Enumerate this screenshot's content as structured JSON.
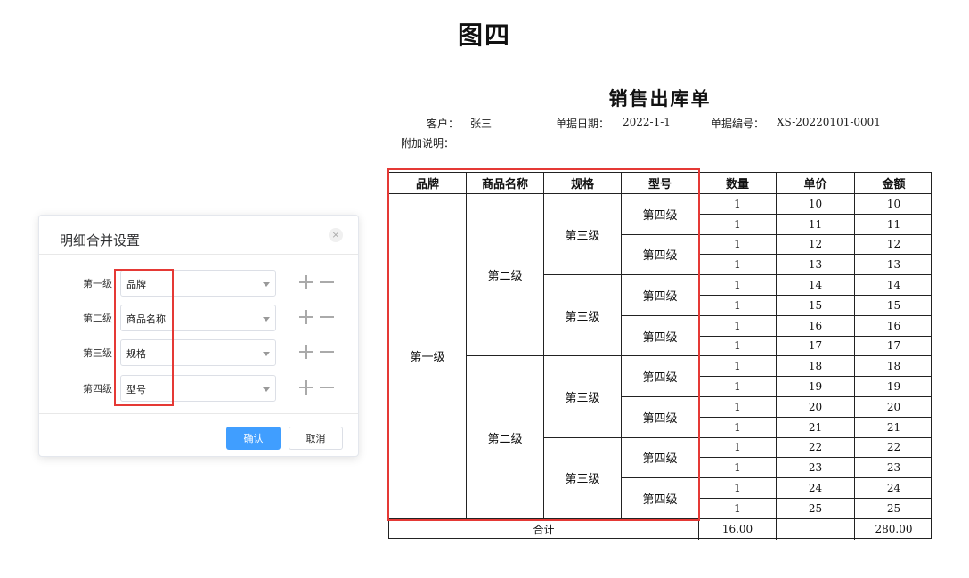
{
  "figure_title": "图四",
  "dialog": {
    "title": "明细合并设置",
    "close_glyph": "×",
    "levels": [
      {
        "label": "第一级",
        "value": "品牌"
      },
      {
        "label": "第二级",
        "value": "商品名称"
      },
      {
        "label": "第三级",
        "value": "规格"
      },
      {
        "label": "第四级",
        "value": "型号"
      }
    ],
    "confirm_label": "确认",
    "cancel_label": "取消",
    "accent_color": "#409eff"
  },
  "document": {
    "title": "销售出库单",
    "customer_label": "客户：",
    "customer_value": "张三",
    "date_label": "单据日期：",
    "date_value": "2022-1-1",
    "number_label": "单据编号：",
    "number_value": "XS-20220101-0001",
    "note_label": "附加说明：",
    "headers": [
      "品牌",
      "商品名称",
      "规格",
      "型号",
      "数量",
      "单价",
      "金额"
    ],
    "merged": {
      "level1": "第一级",
      "level2": "第二级",
      "level3": "第三级",
      "level4": "第四级"
    },
    "rows": [
      {
        "qty": "1",
        "price": "10",
        "amount": "10"
      },
      {
        "qty": "1",
        "price": "11",
        "amount": "11"
      },
      {
        "qty": "1",
        "price": "12",
        "amount": "12"
      },
      {
        "qty": "1",
        "price": "13",
        "amount": "13"
      },
      {
        "qty": "1",
        "price": "14",
        "amount": "14"
      },
      {
        "qty": "1",
        "price": "15",
        "amount": "15"
      },
      {
        "qty": "1",
        "price": "16",
        "amount": "16"
      },
      {
        "qty": "1",
        "price": "17",
        "amount": "17"
      },
      {
        "qty": "1",
        "price": "18",
        "amount": "18"
      },
      {
        "qty": "1",
        "price": "19",
        "amount": "19"
      },
      {
        "qty": "1",
        "price": "20",
        "amount": "20"
      },
      {
        "qty": "1",
        "price": "21",
        "amount": "21"
      },
      {
        "qty": "1",
        "price": "22",
        "amount": "22"
      },
      {
        "qty": "1",
        "price": "23",
        "amount": "23"
      },
      {
        "qty": "1",
        "price": "24",
        "amount": "24"
      },
      {
        "qty": "1",
        "price": "25",
        "amount": "25"
      }
    ],
    "total_label": "合计",
    "total_qty": "16.00",
    "total_price": "",
    "total_amount": "280.00"
  },
  "highlight_color": "#e53935"
}
